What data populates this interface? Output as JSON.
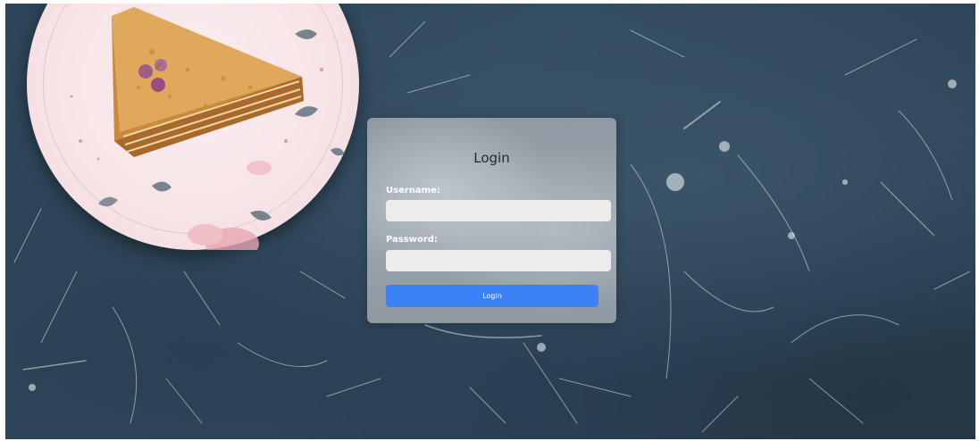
{
  "login": {
    "title": "Login",
    "username_label": "Username:",
    "username_value": "",
    "password_label": "Password:",
    "password_value": "",
    "submit_label": "Login"
  },
  "colors": {
    "button_bg": "#3b82f6",
    "button_text": "#ffffff",
    "input_bg": "#ececec",
    "label_text": "#ffffff",
    "title_text": "#1f2a33",
    "background": "#2e4558"
  }
}
